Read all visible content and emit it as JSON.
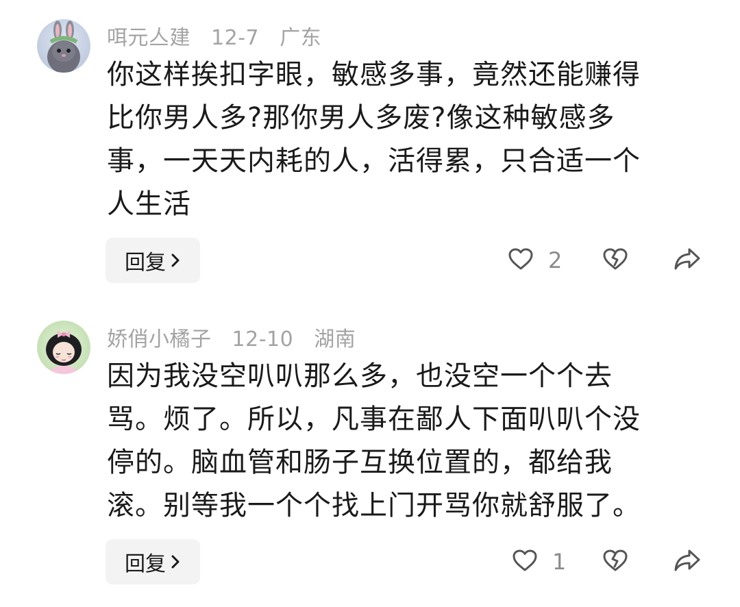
{
  "comments": [
    {
      "username": "咡元亼建",
      "date": "12-7",
      "location": "广东",
      "lines": [
        "你这样挨扣字眼，敏感多事，竟然还能赚得",
        "比你男人多?那你男人多废?像这种敏感多",
        "事，一天天内耗的人，活得累，只合适一个",
        "人生活"
      ],
      "reply_label": "回复",
      "like_count": "2",
      "avatar": "bunny-avatar"
    },
    {
      "username": "娇俏小橘子",
      "date": "12-10",
      "location": "湖南",
      "lines": [
        "因为我没空叭叭那么多，也没空一个个去",
        "骂。烦了。所以，凡事在鄙人下面叭叭个没",
        "停的。脑血管和肠子互换位置的，都给我",
        "滚。别等我一个个找上门开骂你就舒服了。"
      ],
      "reply_label": "回复",
      "like_count": "1",
      "avatar": "girl-avatar"
    }
  ],
  "icons": {
    "like": "heart-icon",
    "dislike": "broken-heart-icon",
    "share": "share-icon",
    "chevron": "chevron-right-icon"
  },
  "colors": {
    "meta": "#a3a3a3",
    "text": "#1a1a1a",
    "icon": "#555555",
    "reply_bg": "#f3f3f3"
  }
}
